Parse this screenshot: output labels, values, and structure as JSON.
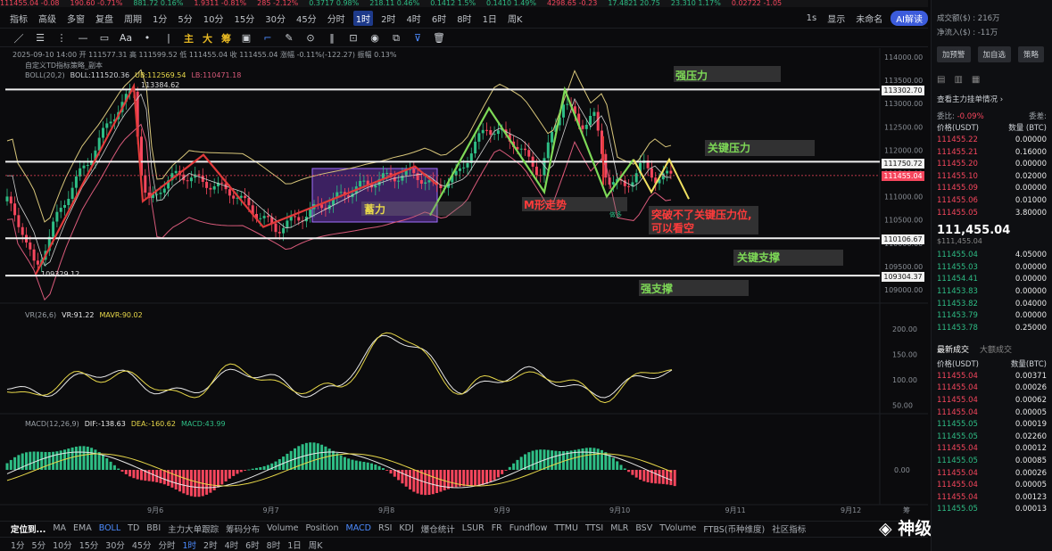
{
  "ticker": [
    "111455.04 -0.08",
    "190.60 -0.71%",
    "881.72 0.16%",
    "1.9311 -0.81%",
    "285 -2.12%",
    "0.3717 0.98%",
    "218.11 0.46%",
    "0.1412 1.5%",
    "0.1410 1.49%",
    "4298.65 -0.23",
    "17.4821 20.75",
    "23.310 1.17%",
    "0.02722 -1.05"
  ],
  "toolbar": {
    "items": [
      "指标",
      "高级",
      "多窗",
      "复盘",
      "周期",
      "1分",
      "5分",
      "10分",
      "15分",
      "30分",
      "45分",
      "分时",
      "1时",
      "2时",
      "4时",
      "6时",
      "8时",
      "1日",
      "周K"
    ],
    "active": "1时",
    "right": [
      "1s",
      "显示",
      "未命名",
      "AI解读"
    ]
  },
  "drawbar": {
    "text_tool": "Aa",
    "cn_tools": [
      "主",
      "大",
      "筹"
    ]
  },
  "legend": {
    "date_line": "2025-09-10 14:00 开 111577.31 高 111599.52 低 111455.04 收 111455.04 涨幅 -0.11%(-122.27) 振幅 0.13%",
    "strategy": "自定义TD指标策略_副本",
    "boll_name": "BOLL(20,2)",
    "boll_val": "BOLL:111520.36",
    "ub": "UB:112569.54",
    "lb": "LB:110471.18"
  },
  "yaxis": [
    "114000.00",
    "113500.00",
    "113000.00",
    "112500.00",
    "112000.00",
    "111500.00",
    "111000.00",
    "110500.00",
    "110000.00",
    "109500.00",
    "109000.00"
  ],
  "price_tags": {
    "strong_res": "113302.70",
    "key_res": "111750.72",
    "current": "111455.04",
    "key_sup": "110106.67",
    "strong_sup": "109304.37"
  },
  "marks": {
    "high": "113384.62",
    "low": "109329.12",
    "small": "做多"
  },
  "annotations": {
    "strong_res": "强压力",
    "key_res": "关键压力",
    "key_sup": "关键支撑",
    "strong_sup": "强支撑",
    "accum": "蓄力",
    "m_shape": "M形走势",
    "note1": "突破不了关键压力位,",
    "note2": "可以看空"
  },
  "vr": {
    "name": "VR(26,6)",
    "val": "VR:91.22",
    "mavr": "MAVR:90.02",
    "axis": [
      "200.00",
      "150.00",
      "100.00",
      "50.00"
    ]
  },
  "macd": {
    "name": "MACD(12,26,9)",
    "dif": "DIF:-138.63",
    "dea": "DEA:-160.62",
    "macd": "MACD:43.99",
    "axis": [
      "0.00"
    ]
  },
  "xaxis": [
    "9月6",
    "9月7",
    "9月8",
    "9月9",
    "9月10",
    "9月11",
    "9月12"
  ],
  "xaxis_extra": "筹",
  "bottom1": [
    "定位到...",
    "MA",
    "EMA",
    "BOLL",
    "TD",
    "BBI",
    "主力大单跟踪",
    "筹码分布",
    "Volume",
    "Position",
    "MACD",
    "RSI",
    "KDJ",
    "爆仓统计",
    "LSUR",
    "FR",
    "Fundflow",
    "TTMU",
    "TTSI",
    "MLR",
    "BSV",
    "TVolume",
    "FTBS(币种维度)",
    "社区指标"
  ],
  "bottom1_active": [
    "BOLL",
    "MACD"
  ],
  "bottom2": [
    "1分",
    "5分",
    "10分",
    "15分",
    "30分",
    "45分",
    "分时",
    "1时",
    "2时",
    "4时",
    "6时",
    "8时",
    "1日",
    "周K"
  ],
  "bottom2_active": "1时",
  "watermark": "神级猎手星哥",
  "side": {
    "turnover": "成交额($) : 216万",
    "netflow": "净流入($) : -11万",
    "buttons": [
      "加预警",
      "加自选",
      "策略"
    ],
    "main_orders": "查看主力挂单情况",
    "ratio_label1": "委比:",
    "ratio_val1": "-0.09%",
    "ratio_label2": "委差:",
    "price_hdr": "价格(USDT)",
    "qty_hdr": "数量 (BTC)",
    "asks": [
      [
        "111455.22",
        "0.00000"
      ],
      [
        "111455.21",
        "0.16000"
      ],
      [
        "111455.20",
        "0.00000"
      ],
      [
        "111455.10",
        "0.02000"
      ],
      [
        "111455.09",
        "0.00000"
      ],
      [
        "111455.06",
        "0.01000"
      ],
      [
        "111455.05",
        "3.80000"
      ]
    ],
    "last_price": "111,455.04",
    "last_usd": "$111,455.04",
    "bids": [
      [
        "111455.04",
        "4.05000"
      ],
      [
        "111455.03",
        "0.00000"
      ],
      [
        "111454.41",
        "0.00000"
      ],
      [
        "111453.83",
        "0.00000"
      ],
      [
        "111453.82",
        "0.04000"
      ],
      [
        "111453.79",
        "0.00000"
      ],
      [
        "111453.78",
        "0.25000"
      ]
    ],
    "tabs": [
      "最新成交",
      "大额成交"
    ],
    "trade_price_hdr": "价格(USDT)",
    "trade_qty_hdr": "数量(BTC)",
    "trades": [
      [
        "111455.04",
        "0.00371",
        "s"
      ],
      [
        "111455.04",
        "0.00026",
        "s"
      ],
      [
        "111455.04",
        "0.00062",
        "s"
      ],
      [
        "111455.04",
        "0.00005",
        "s"
      ],
      [
        "111455.05",
        "0.00019",
        "b"
      ],
      [
        "111455.05",
        "0.02260",
        "b"
      ],
      [
        "111455.04",
        "0.00012",
        "s"
      ],
      [
        "111455.05",
        "0.00085",
        "b"
      ],
      [
        "111455.04",
        "0.00026",
        "s"
      ],
      [
        "111455.04",
        "0.00005",
        "s"
      ],
      [
        "111455.04",
        "0.00123",
        "s"
      ],
      [
        "111455.05",
        "0.00013",
        "b"
      ]
    ]
  },
  "colors": {
    "up": "#2ebd85",
    "down": "#f6465d",
    "boll": "#d8c67a",
    "accent": "#1e3a8a"
  }
}
